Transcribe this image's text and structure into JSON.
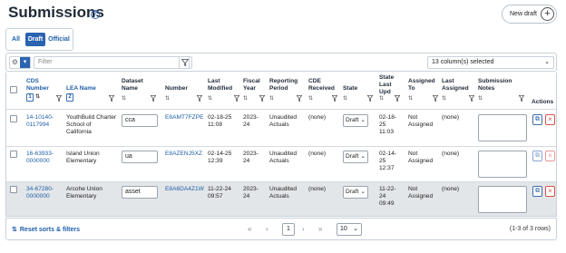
{
  "page": {
    "title": "Submissions",
    "help_icon": "question-circle-icon",
    "new_draft_label": "New draft",
    "new_draft_icon": "plus-circle-icon"
  },
  "tabs": [
    {
      "label": "All",
      "selected": false
    },
    {
      "label": "Draft",
      "selected": true
    },
    {
      "label": "Official",
      "selected": false
    }
  ],
  "filter": {
    "placeholder": "Filter",
    "columns_selected": "13 column(s) selected"
  },
  "columns": {
    "cds_number": "CDS Number",
    "cds_sort_order": "1",
    "lea_name": "LEA Name",
    "lea_sort_order": "2",
    "dataset_name": "Dataset Name",
    "number": "Number",
    "last_modified": "Last Modified",
    "fiscal_year": "Fiscal Year",
    "reporting_period": "Reporting Period",
    "cde_received": "CDE Received",
    "state": "State",
    "state_last_upd": "State Last Upd",
    "assigned_to": "Assigned To",
    "last_assigned": "Last Assigned",
    "submission_notes": "Submission Notes",
    "actions": "Actions"
  },
  "rows": [
    {
      "cds_number": "14-10140-0117994",
      "lea_name": "YouthBuild Charter School of California",
      "dataset_name": "cca",
      "number": "E8AMT7FZPE",
      "last_modified": "02-18-25 11:08",
      "fiscal_year": "2023-24",
      "reporting_period": "Unaudited Actuals",
      "cde_received": "(none)",
      "state": "Draft",
      "state_last_upd": "02-18-25 11:03",
      "assigned_to": "Not Assigned",
      "last_assigned": "(none)"
    },
    {
      "cds_number": "16-63933-0000000",
      "lea_name": "Island Union Elementary",
      "dataset_name": "ua",
      "number": "E8AZENJ5XZ",
      "last_modified": "02-14-25 12:39",
      "fiscal_year": "2023-24",
      "reporting_period": "Unaudited Actuals",
      "cde_received": "(none)",
      "state": "Draft",
      "state_last_upd": "02-14-25 12:37",
      "assigned_to": "Not Assigned",
      "last_assigned": "(none)"
    },
    {
      "cds_number": "34-67280-0000000",
      "lea_name": "Arcohe Union Elementary",
      "dataset_name": "asset",
      "number": "E8A6DA4Z1W",
      "last_modified": "11-22-24 09:57",
      "fiscal_year": "2023-24",
      "reporting_period": "Unaudited Actuals",
      "cde_received": "(none)",
      "state": "Draft",
      "state_last_upd": "11-22-24 09:49",
      "assigned_to": "Not Assigned",
      "last_assigned": "(none)"
    }
  ],
  "footer": {
    "reset_label": "Reset sorts & filters",
    "current_page": "1",
    "per_page": "10",
    "rows_count": "(1-3 of 3 rows)"
  }
}
